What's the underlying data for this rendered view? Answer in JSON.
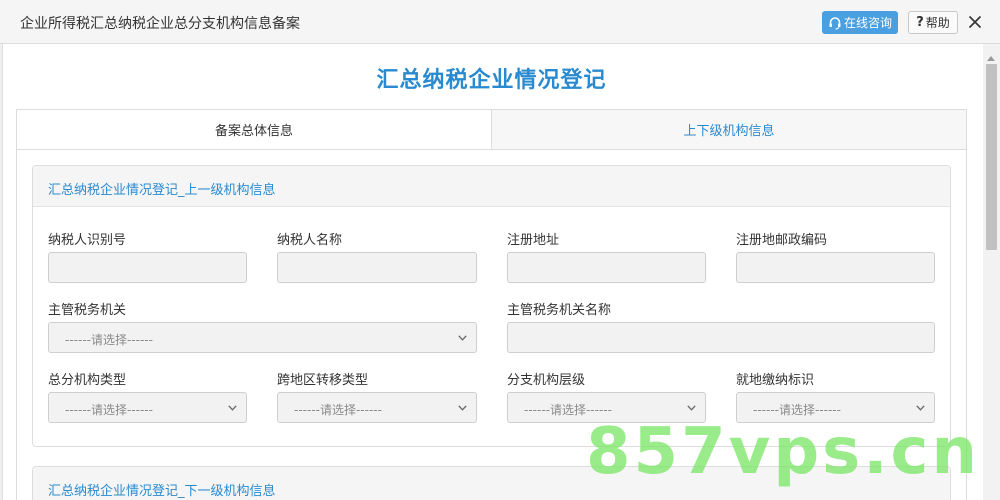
{
  "window": {
    "title": "企业所得税汇总纳税企业总分支机构信息备案",
    "consult_label": "在线咨询",
    "help_label": "帮助"
  },
  "page": {
    "title": "汇总纳税企业情况登记"
  },
  "tabs": [
    {
      "label": "备案总体信息",
      "active": true
    },
    {
      "label": "上下级机构信息",
      "active": false
    }
  ],
  "section1": {
    "title": "汇总纳税企业情况登记_上一级机构信息",
    "fields": {
      "taxpayer_id": {
        "label": "纳税人识别号",
        "value": ""
      },
      "taxpayer_name": {
        "label": "纳税人名称",
        "value": ""
      },
      "reg_address": {
        "label": "注册地址",
        "value": ""
      },
      "reg_postcode": {
        "label": "注册地邮政编码",
        "value": ""
      },
      "tax_authority": {
        "label": "主管税务机关",
        "placeholder": "------请选择------"
      },
      "tax_authority_name": {
        "label": "主管税务机关名称",
        "value": ""
      },
      "branch_type": {
        "label": "总分机构类型",
        "placeholder": "------请选择------"
      },
      "transfer_type": {
        "label": "跨地区转移类型",
        "placeholder": "------请选择------"
      },
      "branch_level": {
        "label": "分支机构层级",
        "placeholder": "------请选择------"
      },
      "local_pay_flag": {
        "label": "就地缴纳标识",
        "placeholder": "------请选择------"
      }
    }
  },
  "section2": {
    "title": "汇总纳税企业情况登记_下一级机构信息"
  },
  "watermark": "857vps.cn",
  "colors": {
    "accent": "#2a8ad0",
    "consult_button": "#4a9fe0",
    "input_bg": "#f2f2f2",
    "watermark": "#78e664"
  },
  "icons": {
    "consult": "headset-icon",
    "help": "question-icon",
    "close": "close-icon",
    "select": "chevron-down-icon"
  }
}
